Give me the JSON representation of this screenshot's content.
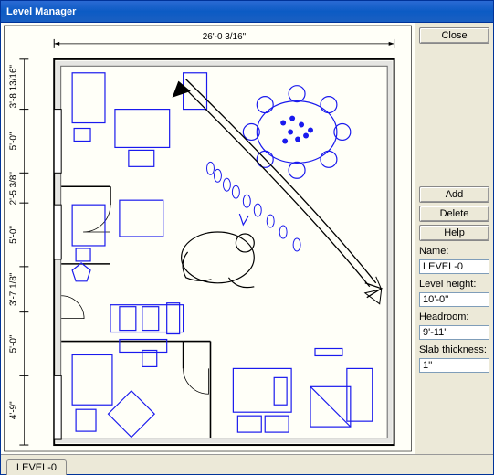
{
  "window": {
    "title": "Level Manager"
  },
  "buttons": {
    "close": "Close",
    "add": "Add",
    "delete": "Delete",
    "help": "Help"
  },
  "labels": {
    "name": "Name:",
    "level_height": "Level height:",
    "headroom": "Headroom:",
    "slab_thickness": "Slab thickness:"
  },
  "fields": {
    "name": "LEVEL-0",
    "level_height": "10'-0''",
    "headroom": "9'-11''",
    "slab_thickness": "1''"
  },
  "dimensions": {
    "top": "26'-0 3/16\"",
    "left": [
      "3'-8 13/16\"",
      "5'-0\"",
      "2'-5 3/8\"",
      "5'-0\"",
      "3'-7 1/8\"",
      "5'-0\"",
      "4'-9\""
    ]
  },
  "tabs": {
    "active_label": "LEVEL-0"
  }
}
